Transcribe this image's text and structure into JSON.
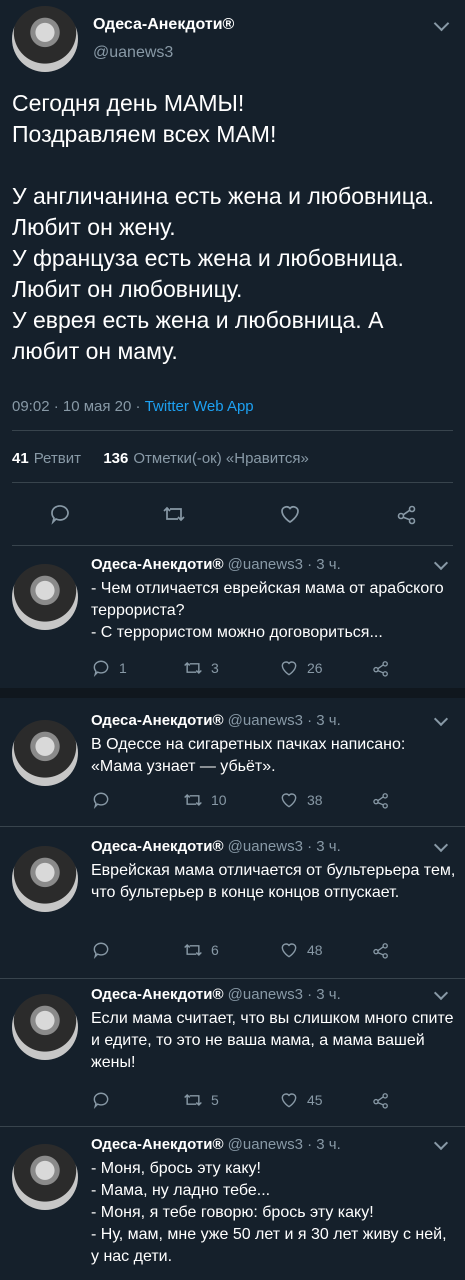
{
  "tweet": {
    "author_name": "Одеса-Анекдоти®",
    "author_handle": "@uanews3",
    "text": "Сегодня день МАМЫ!\nПоздравляем всех МАМ!\n\nУ англичанина есть жена и любовница. Любит он жену.\nУ француза есть жена и любовница. Любит он любовницу.\nУ еврея есть жена и любовница. А любит он маму.",
    "timestamp": "09:02 · 10 мая 20 · ",
    "source": "Twitter Web App",
    "retweets_count": "41",
    "retweets_label": "Ретвит",
    "likes_count": "136",
    "likes_label": "Отметки(-ок) «Нравится»"
  },
  "icons": {
    "reply": "reply-icon",
    "retweet": "retweet-icon",
    "like": "heart-icon",
    "share": "share-icon",
    "more": "chevron-down-icon"
  },
  "colors": {
    "background": "#15202b",
    "secondary_text": "#8899a6",
    "link": "#1da1f2",
    "divider": "#38444d"
  },
  "replies": [
    {
      "name": "Одеса-Анекдоти®",
      "meta": "@uanews3 · 3 ч.",
      "text": "- Чем отличается еврейская мама от арабского террориста?\n- С террористом можно договориться...",
      "reply_count": "1",
      "retweet_count": "3",
      "like_count": "26"
    },
    {
      "name": "Одеса-Анекдоти®",
      "meta": "@uanews3 · 3 ч.",
      "text": "В Одессе на сигаретных пачках написано: «Мама узнает — убьёт».",
      "reply_count": "",
      "retweet_count": "10",
      "like_count": "38"
    },
    {
      "name": "Одеса-Анекдоти®",
      "meta": "@uanews3 · 3 ч.",
      "text": "Еврейская мама отличается от бультерьера тем, что бультерьер в конце концов отпускает.",
      "reply_count": "",
      "retweet_count": "6",
      "like_count": "48"
    },
    {
      "name": "Одеса-Анекдоти®",
      "meta": "@uanews3 · 3 ч.",
      "text": "Если мама считает, что вы слишком много спите и едите, то это не ваша мама, а мама вашей жены!",
      "reply_count": "",
      "retweet_count": "5",
      "like_count": "45"
    },
    {
      "name": "Одеса-Анекдоти®",
      "meta": "@uanews3 · 3 ч.",
      "text": "- Моня, брось эту каку!\n- Мама, ну ладно тебе...\n- Моня, я тебе говорю: брось эту каку!\n- Ну, мам, мне уже 50 лет и я 30 лет живу с ней, у нас дети.",
      "reply_count": "",
      "retweet_count": "",
      "like_count": ""
    }
  ]
}
